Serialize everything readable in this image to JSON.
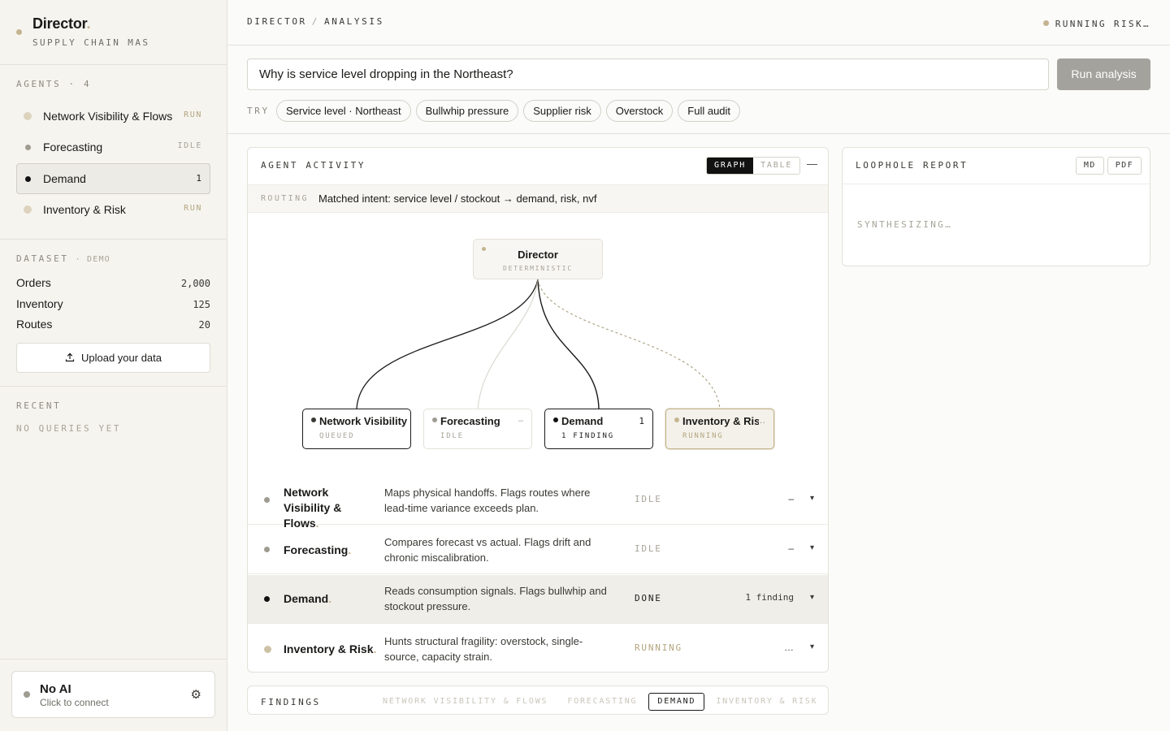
{
  "brand": {
    "title": "Director",
    "accent": ".",
    "subtitle": "SUPPLY CHAIN MAS"
  },
  "sidebar": {
    "agents_header": "AGENTS · 4",
    "agents": [
      {
        "label": "Network Visibility & Flows",
        "status": "RUN",
        "dot_color": "#ddd3bd"
      },
      {
        "label": "Forecasting",
        "status": "IDLE",
        "dot_color": "#9e9b90"
      },
      {
        "label": "Demand",
        "status": "1",
        "dot_color": "#111111"
      },
      {
        "label": "Inventory & Risk",
        "status": "RUN",
        "dot_color": "#ddd3bd"
      }
    ],
    "dataset_header": "DATASET",
    "dataset_tag": "· DEMO",
    "dataset": [
      {
        "label": "Orders",
        "value": "2,000"
      },
      {
        "label": "Inventory",
        "value": "125"
      },
      {
        "label": "Routes",
        "value": "20"
      }
    ],
    "upload_label": "Upload your data",
    "recent_header": "RECENT",
    "recent_empty": "NO QUERIES YET",
    "ai": {
      "title": "No AI",
      "subtitle": "Click to connect"
    }
  },
  "header": {
    "crumb_1": "DIRECTOR",
    "crumb_sep": "/",
    "crumb_2": "ANALYSIS",
    "status": "RUNNING RISK…"
  },
  "query": {
    "value": "Why is service level dropping in the Northeast?",
    "run_label": "Run analysis",
    "try_label": "TRY",
    "chips": [
      "Service level · Northeast",
      "Bullwhip pressure",
      "Supplier risk",
      "Overstock",
      "Full audit"
    ]
  },
  "activity": {
    "title": "AGENT ACTIVITY",
    "toggle": [
      "GRAPH",
      "TABLE"
    ],
    "collapse": "—",
    "routing_key": "ROUTING",
    "routing_value": "Matched intent: service level / stockout → demand, risk, nvf",
    "graph": {
      "director": {
        "name": "Director",
        "sub": "DETERMINISTIC"
      },
      "nodes": [
        {
          "name": "Network Visibility & Flows",
          "sub": "QUEUED",
          "right": ""
        },
        {
          "name": "Forecasting",
          "sub": "IDLE",
          "right": "–"
        },
        {
          "name": "Demand",
          "sub": "1 FINDING",
          "right": "1"
        },
        {
          "name": "Inventory & Risk",
          "sub": "RUNNING",
          "right": "…"
        }
      ]
    },
    "rows": [
      {
        "name": "Network Visibility & Flows",
        "desc": "Maps physical handoffs. Flags routes where lead-time variance exceeds plan.",
        "status": "IDLE",
        "count": "–"
      },
      {
        "name": "Forecasting",
        "desc": "Compares forecast vs actual. Flags drift and chronic miscalibration.",
        "status": "IDLE",
        "count": "–"
      },
      {
        "name": "Demand",
        "desc": "Reads consumption signals. Flags bullwhip and stockout pressure.",
        "status": "DONE",
        "count": "1 finding"
      },
      {
        "name": "Inventory & Risk",
        "desc": "Hunts structural fragility: overstock, single-source, capacity strain.",
        "status": "RUNNING",
        "count": "…"
      }
    ],
    "chevron": "▾"
  },
  "findings": {
    "title": "FINDINGS",
    "tabs": [
      "NETWORK VISIBILITY & FLOWS",
      "FORECASTING",
      "DEMAND",
      "INVENTORY & RISK"
    ]
  },
  "report": {
    "title": "LOOPHOLE REPORT",
    "md": "MD",
    "pdf": "PDF",
    "status": "SYNTHESIZING…"
  }
}
